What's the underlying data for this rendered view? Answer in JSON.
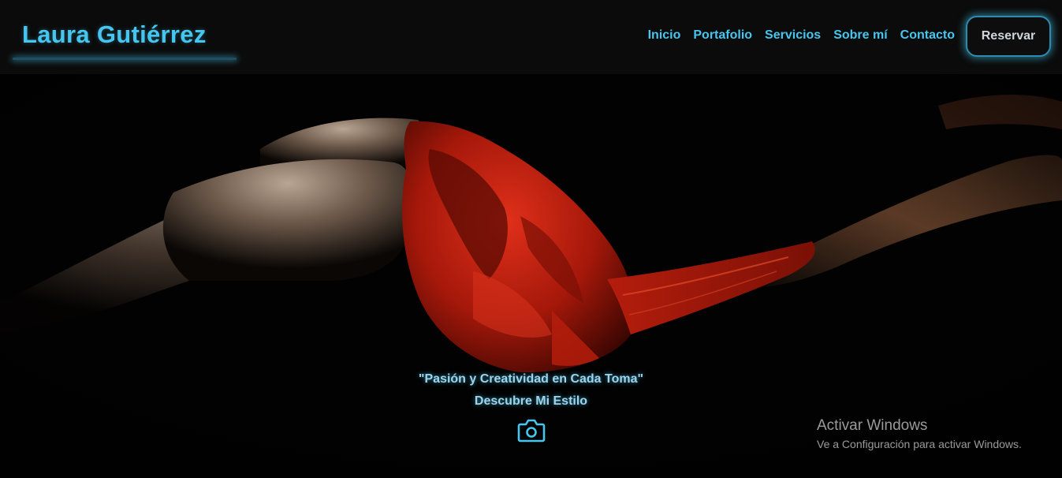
{
  "header": {
    "brand": "Laura Gutiérrez",
    "nav": [
      "Inicio",
      "Portafolio",
      "Servicios",
      "Sobre mí",
      "Contacto"
    ],
    "cta_label": "Reservar"
  },
  "hero": {
    "tagline": "\"Pasión y Creatividad en Cada Toma\"",
    "subtitle": "Descubre Mi Estilo",
    "cta_icon": "camera-icon"
  },
  "watermark": {
    "title": "Activar Windows",
    "subtitle": "Ve a Configuración para activar Windows."
  },
  "colors": {
    "accent": "#46c6ef",
    "header_bg": "#0b0b0b",
    "hero_bg": "#020202",
    "fabric": "#c4210f"
  }
}
